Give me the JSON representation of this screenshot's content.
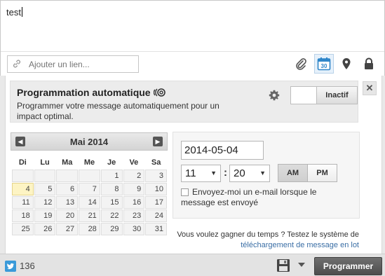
{
  "composer": {
    "message": "test",
    "link_placeholder": "Ajouter un lien...",
    "tools": [
      "paperclip-icon",
      "calendar-icon",
      "location-pin-icon",
      "lock-icon"
    ],
    "calendar_badge": "30"
  },
  "schedule": {
    "title": "Programmation automatique",
    "description": "Programmer votre message automatiquement pour un impact optimal.",
    "toggle_label": "Inactif",
    "close_label": "✕"
  },
  "calendar": {
    "month": "Mai 2014",
    "prev": "◀",
    "next": "▶",
    "weekdays": [
      "Di",
      "Lu",
      "Ma",
      "Me",
      "Je",
      "Ve",
      "Sa"
    ],
    "weeks": [
      [
        "",
        "",
        "",
        "",
        "1",
        "2",
        "3"
      ],
      [
        "4",
        "5",
        "6",
        "7",
        "8",
        "9",
        "10"
      ],
      [
        "11",
        "12",
        "13",
        "14",
        "15",
        "16",
        "17"
      ],
      [
        "18",
        "19",
        "20",
        "21",
        "22",
        "23",
        "24"
      ],
      [
        "25",
        "26",
        "27",
        "28",
        "29",
        "30",
        "31"
      ]
    ],
    "selected": "4"
  },
  "time": {
    "date": "2014-05-04",
    "hour": "11",
    "minute": "20",
    "am": "AM",
    "pm": "PM",
    "selected_period": "AM",
    "colon": ":",
    "arrow": "▼",
    "email_label": "Envoyez-moi un e-mail lorsque le message est envoyé"
  },
  "promo": {
    "text": "Vous voulez gagner du temps ? Testez le système de",
    "link": "téléchargement de message en lot"
  },
  "footer": {
    "count": "136",
    "submit": "Programmer"
  },
  "colors": {
    "twitter": "#3a9ad9",
    "link": "#3a6ea5",
    "selected_day": "#fdf4c4",
    "calendar_icon": "#2f86c9"
  }
}
